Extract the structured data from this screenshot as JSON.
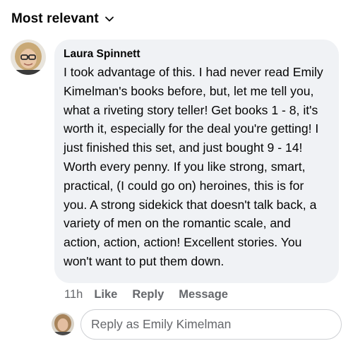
{
  "sort": {
    "label": "Most relevant",
    "icon": "chevron-down-icon"
  },
  "comment": {
    "author": "Laura Spinnett",
    "text": "I took advantage of this. I had never read Emily Kimelman's books before, but, let me tell you, what a riveting story teller! Get books 1 - 8, it's worth it, especially for the deal you're getting! I just finished this set, and just bought 9 - 14! Worth every penny. If you like strong, smart, practical, (I could go on) heroines, this is for you. A strong sidekick that doesn't talk back, a variety of men on the romantic scale, and action, action, action! Excellent stories. You won't want to put them down.",
    "time": "11h",
    "actions": {
      "like": "Like",
      "reply": "Reply",
      "message": "Message"
    }
  },
  "reply": {
    "placeholder": "Reply as Emily Kimelman"
  },
  "colors": {
    "bubble": "#f0f2f5",
    "meta_text": "#65676b",
    "text": "#050505",
    "input_border": "#ced0d4"
  }
}
